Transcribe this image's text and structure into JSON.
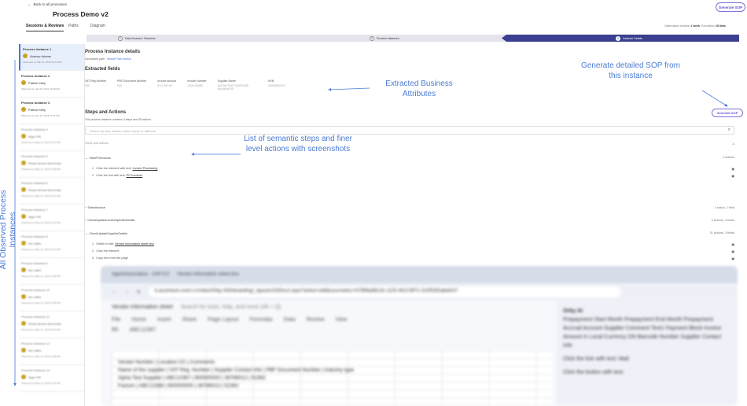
{
  "header": {
    "back_label": "Back to all processes",
    "title": "Process Demo v2",
    "tabs": [
      "Sessions & Reviews",
      "Paths",
      "Diagram"
    ],
    "generate_sop": "Generate SOP",
    "obs_label": "Observation duration",
    "obs_value": "1 week",
    "exec_label": "Executions",
    "exec_value": "18 links"
  },
  "stepper": [
    {
      "num": "1",
      "label": "Data Sources / Sessions"
    },
    {
      "num": "2",
      "label": "Process Instances"
    },
    {
      "num": "3",
      "label": "Instance Details"
    }
  ],
  "sidebar": {
    "instances": [
      {
        "name": "Process Instance 1",
        "user": "Andrew Adams",
        "date": "Observed on Mar 21, 2024 06:03 PM"
      },
      {
        "name": "Process Instance 2",
        "user": "Patrick Kelly",
        "date": "Observed on Jan 09, 2024 12:29 AM"
      },
      {
        "name": "Process Instance 3",
        "user": "Patrick Kelly",
        "date": "Observed on Jan 11, 2024 07:01 AM"
      },
      {
        "name": "Process Instance 4",
        "user": "Nigel Pilt",
        "date": "Observed on May 21, 2024 01:07 PM"
      },
      {
        "name": "Process Instance 5",
        "user": "Rhiad Ahmed Bennhasi",
        "date": "Observed on May 13, 2024 10:09 PM"
      },
      {
        "name": "Process Instance 6",
        "user": "Rhiad Ahmed Bennhasi",
        "date": "Observed on May 13, 2024 10:21 PM"
      },
      {
        "name": "Process Instance 7",
        "user": "Nigel Pilt",
        "date": "Observed on May 13, 2024 10:33 PM"
      },
      {
        "name": "Process Instance 8",
        "user": "Md Jaffer",
        "date": "Observed on May 13, 2024 10:41 PM"
      },
      {
        "name": "Process Instance 9",
        "user": "Md Jaffer",
        "date": "Observed on May 13, 2024 10:45 PM"
      },
      {
        "name": "Process Instance 10",
        "user": "Md Jaffer",
        "date": "Observed on May 13, 2024 10:50 PM"
      },
      {
        "name": "Process Instance 11",
        "user": "Rhiad Ahmed Bennhasi",
        "date": "Observed on May 13, 2024 10:53 PM"
      },
      {
        "name": "Process Instance 12",
        "user": "Md Jaffer",
        "date": "Observed on May 13, 2024 10:58 PM"
      },
      {
        "name": "Process Instance 13",
        "user": "Nigel Pilt",
        "date": "Observed on May 13, 2024 11:02 PM"
      }
    ]
  },
  "details": {
    "title": "Process Instance details",
    "path_label": "Associated path :",
    "path_link": "Simple Path Invoice",
    "fields_title": "Extracted fields",
    "fields": [
      {
        "k": "VAT Reg Number",
        "v": "N/A"
      },
      {
        "k": "PBF Document Number",
        "v": "N/A"
      },
      {
        "k": "Invoice Amount",
        "v": "$ 12,760.00"
      },
      {
        "k": "Invoice Number",
        "v": "11111-53456"
      },
      {
        "k": "Supplier Name",
        "v": "ALPHA TEST SUPPLIER Archaeval St"
      },
      {
        "k": "URN",
        "v": "152000001117"
      }
    ],
    "steps_title": "Steps and Actions",
    "steps_sub": "This process instance contains 4 steps and 38 actions",
    "search_placeholder": "Search by step names, action name or attribute",
    "steps_header": "Steps and actions",
    "generate_sop": "Generate SOP"
  },
  "steps": [
    {
      "name": "ViewPOInvoices",
      "meta": "2 actions"
    },
    {
      "name": "SelectInvoice",
      "meta": "1 action, 1 field"
    },
    {
      "name": "CheckUpdateInvoiceSpecificDetails",
      "meta": "4 actions, 4 fields"
    },
    {
      "name": "CheckUpdateSupplierDetails",
      "meta": "31 actions, 3 fields"
    }
  ],
  "actions_a": [
    {
      "n": "1",
      "text": "Click the element with text:",
      "u": "Invoice Processing"
    },
    {
      "n": "2",
      "text": "Click the link with text:",
      "u": "PO Invoices"
    }
  ],
  "actions_b": [
    {
      "n": "1",
      "text": "Switch to tab:",
      "u": "Vendor information sheet.xlsx"
    },
    {
      "n": "2",
      "text": "Click the element",
      "u": ""
    },
    {
      "n": "3",
      "text": "Copy text from the page",
      "u": ""
    }
  ],
  "annotations": {
    "fields": "Extracted Business Attributes",
    "sop": "Generate detailed SOP from this instance",
    "steps": "List of semantic steps and finer level actions with screenshots",
    "sidebar": "All Observed Process Instances"
  },
  "screenshot": {
    "tab1": "AgentAutomation - SAP 6.0",
    "tab2": "Vendor information sheet.xlsx",
    "url": "b.accenture.com/:x:/r/sites/Orby-AIOnboarding/_layouts/15/Doc2.aspx?action=edit&sourcedoc=%7B6ba8b13c-1102-4fc3-9972-1h2f9292abeb%7",
    "sheet_title": "Vendor information sheet",
    "sheet_search": "Search for tools, help, and more (Alt + Q)",
    "menu": [
      "File",
      "Home",
      "Insert",
      "Share",
      "Page Layout",
      "Formulas",
      "Data",
      "Review",
      "View"
    ],
    "cell_ref": "B5",
    "cell_value": "ABC12367",
    "rows": [
      "Vendor Number | Location CC | Comments",
      "Name of the supplier | VAT Reg. Number | Supplier Contact Info | PBF Document Number | Industry type",
      "Alpha Test Supplier | ABC12367 | 800000000 | 36789012 | 52362",
      "Factum | ABC12368 | 800000000 | 36789013 | 52362"
    ],
    "panel_title": "Orby AI",
    "panel_text": "Prepayment Start Month Prepayment End Month Prepayment Accrual Account Supplier Comment Text1 Payment Block Invoice Amount in Local Currency DN Barcode Number Supplier Contact Info",
    "panel_action1": "Click the link with text: Mail",
    "panel_action2": "Click the button with text:"
  }
}
